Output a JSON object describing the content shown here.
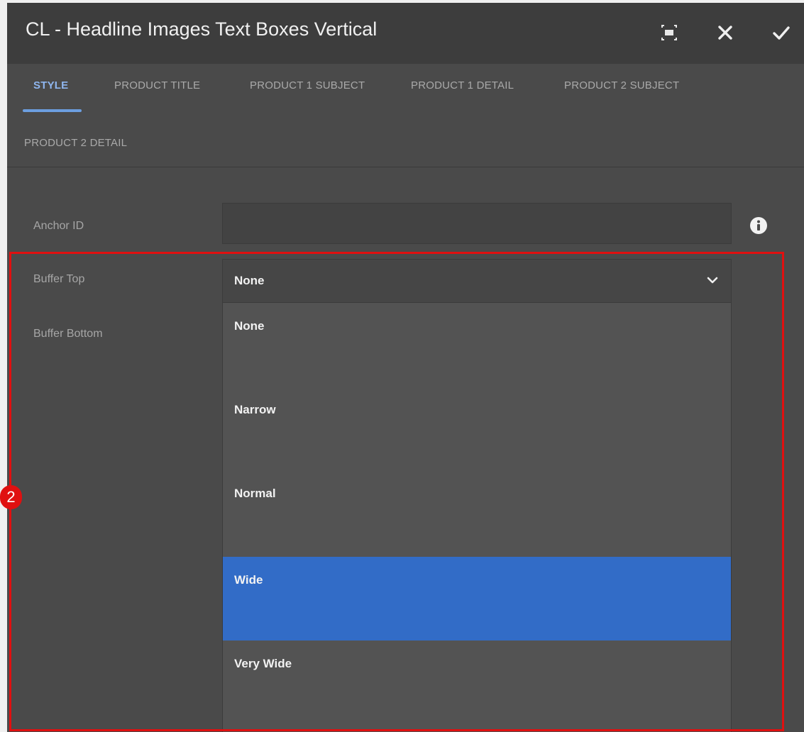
{
  "dialog": {
    "title": "CL - Headline Images Text Boxes Vertical",
    "fullscreen_icon": "fullscreen-icon",
    "close_icon": "close-icon",
    "done_icon": "checkmark-icon"
  },
  "tabs": [
    {
      "label": "STYLE",
      "active": true
    },
    {
      "label": "PRODUCT TITLE",
      "active": false
    },
    {
      "label": "PRODUCT 1 SUBJECT",
      "active": false
    },
    {
      "label": "PRODUCT 1 DETAIL",
      "active": false
    },
    {
      "label": "PRODUCT 2 SUBJECT",
      "active": false
    },
    {
      "label": "PRODUCT 2 DETAIL",
      "active": false
    }
  ],
  "fields": {
    "anchor_id": {
      "label": "Anchor ID",
      "value": "",
      "info_icon": "info-icon"
    },
    "buffer_top": {
      "label": "Buffer Top",
      "value": "None"
    },
    "buffer_bottom": {
      "label": "Buffer Bottom"
    }
  },
  "dropdown": {
    "options": [
      "None",
      "Narrow",
      "Normal",
      "Wide",
      "Very Wide"
    ],
    "highlighted": "Wide"
  },
  "annotation": {
    "step_number": "2"
  },
  "colors": {
    "accent": "#6c9ee0",
    "selected": "#326cc7",
    "highlight_box": "#e01010"
  }
}
